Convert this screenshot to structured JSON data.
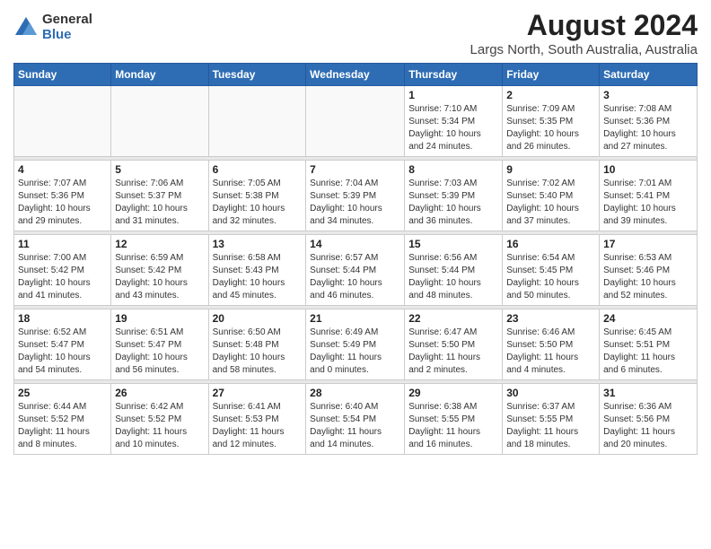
{
  "logo": {
    "general": "General",
    "blue": "Blue"
  },
  "title": "August 2024",
  "subtitle": "Largs North, South Australia, Australia",
  "days_of_week": [
    "Sunday",
    "Monday",
    "Tuesday",
    "Wednesday",
    "Thursday",
    "Friday",
    "Saturday"
  ],
  "weeks": [
    [
      {
        "day": "",
        "info": ""
      },
      {
        "day": "",
        "info": ""
      },
      {
        "day": "",
        "info": ""
      },
      {
        "day": "",
        "info": ""
      },
      {
        "day": "1",
        "info": "Sunrise: 7:10 AM\nSunset: 5:34 PM\nDaylight: 10 hours\nand 24 minutes."
      },
      {
        "day": "2",
        "info": "Sunrise: 7:09 AM\nSunset: 5:35 PM\nDaylight: 10 hours\nand 26 minutes."
      },
      {
        "day": "3",
        "info": "Sunrise: 7:08 AM\nSunset: 5:36 PM\nDaylight: 10 hours\nand 27 minutes."
      }
    ],
    [
      {
        "day": "4",
        "info": "Sunrise: 7:07 AM\nSunset: 5:36 PM\nDaylight: 10 hours\nand 29 minutes."
      },
      {
        "day": "5",
        "info": "Sunrise: 7:06 AM\nSunset: 5:37 PM\nDaylight: 10 hours\nand 31 minutes."
      },
      {
        "day": "6",
        "info": "Sunrise: 7:05 AM\nSunset: 5:38 PM\nDaylight: 10 hours\nand 32 minutes."
      },
      {
        "day": "7",
        "info": "Sunrise: 7:04 AM\nSunset: 5:39 PM\nDaylight: 10 hours\nand 34 minutes."
      },
      {
        "day": "8",
        "info": "Sunrise: 7:03 AM\nSunset: 5:39 PM\nDaylight: 10 hours\nand 36 minutes."
      },
      {
        "day": "9",
        "info": "Sunrise: 7:02 AM\nSunset: 5:40 PM\nDaylight: 10 hours\nand 37 minutes."
      },
      {
        "day": "10",
        "info": "Sunrise: 7:01 AM\nSunset: 5:41 PM\nDaylight: 10 hours\nand 39 minutes."
      }
    ],
    [
      {
        "day": "11",
        "info": "Sunrise: 7:00 AM\nSunset: 5:42 PM\nDaylight: 10 hours\nand 41 minutes."
      },
      {
        "day": "12",
        "info": "Sunrise: 6:59 AM\nSunset: 5:42 PM\nDaylight: 10 hours\nand 43 minutes."
      },
      {
        "day": "13",
        "info": "Sunrise: 6:58 AM\nSunset: 5:43 PM\nDaylight: 10 hours\nand 45 minutes."
      },
      {
        "day": "14",
        "info": "Sunrise: 6:57 AM\nSunset: 5:44 PM\nDaylight: 10 hours\nand 46 minutes."
      },
      {
        "day": "15",
        "info": "Sunrise: 6:56 AM\nSunset: 5:44 PM\nDaylight: 10 hours\nand 48 minutes."
      },
      {
        "day": "16",
        "info": "Sunrise: 6:54 AM\nSunset: 5:45 PM\nDaylight: 10 hours\nand 50 minutes."
      },
      {
        "day": "17",
        "info": "Sunrise: 6:53 AM\nSunset: 5:46 PM\nDaylight: 10 hours\nand 52 minutes."
      }
    ],
    [
      {
        "day": "18",
        "info": "Sunrise: 6:52 AM\nSunset: 5:47 PM\nDaylight: 10 hours\nand 54 minutes."
      },
      {
        "day": "19",
        "info": "Sunrise: 6:51 AM\nSunset: 5:47 PM\nDaylight: 10 hours\nand 56 minutes."
      },
      {
        "day": "20",
        "info": "Sunrise: 6:50 AM\nSunset: 5:48 PM\nDaylight: 10 hours\nand 58 minutes."
      },
      {
        "day": "21",
        "info": "Sunrise: 6:49 AM\nSunset: 5:49 PM\nDaylight: 11 hours\nand 0 minutes."
      },
      {
        "day": "22",
        "info": "Sunrise: 6:47 AM\nSunset: 5:50 PM\nDaylight: 11 hours\nand 2 minutes."
      },
      {
        "day": "23",
        "info": "Sunrise: 6:46 AM\nSunset: 5:50 PM\nDaylight: 11 hours\nand 4 minutes."
      },
      {
        "day": "24",
        "info": "Sunrise: 6:45 AM\nSunset: 5:51 PM\nDaylight: 11 hours\nand 6 minutes."
      }
    ],
    [
      {
        "day": "25",
        "info": "Sunrise: 6:44 AM\nSunset: 5:52 PM\nDaylight: 11 hours\nand 8 minutes."
      },
      {
        "day": "26",
        "info": "Sunrise: 6:42 AM\nSunset: 5:52 PM\nDaylight: 11 hours\nand 10 minutes."
      },
      {
        "day": "27",
        "info": "Sunrise: 6:41 AM\nSunset: 5:53 PM\nDaylight: 11 hours\nand 12 minutes."
      },
      {
        "day": "28",
        "info": "Sunrise: 6:40 AM\nSunset: 5:54 PM\nDaylight: 11 hours\nand 14 minutes."
      },
      {
        "day": "29",
        "info": "Sunrise: 6:38 AM\nSunset: 5:55 PM\nDaylight: 11 hours\nand 16 minutes."
      },
      {
        "day": "30",
        "info": "Sunrise: 6:37 AM\nSunset: 5:55 PM\nDaylight: 11 hours\nand 18 minutes."
      },
      {
        "day": "31",
        "info": "Sunrise: 6:36 AM\nSunset: 5:56 PM\nDaylight: 11 hours\nand 20 minutes."
      }
    ]
  ]
}
